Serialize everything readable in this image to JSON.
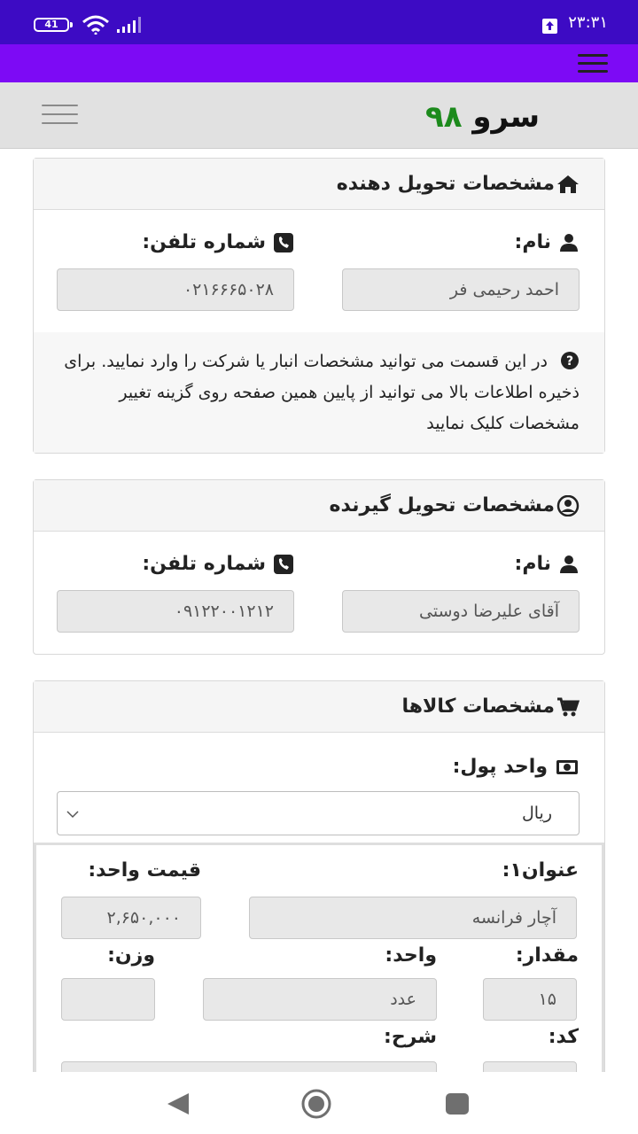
{
  "status_bar": {
    "battery": "41",
    "time": "۲۳:۳۱"
  },
  "app": {
    "logo_word": "سرو",
    "logo_number": "۹۸"
  },
  "sender": {
    "title": "مشخصات تحویل دهنده",
    "name_label": "نام:",
    "name_value": "احمد رحیمی فر",
    "phone_label": "شماره تلفن:",
    "phone_value": "۰۲۱۶۶۶۵۰۲۸",
    "help_text": "در این قسمت می توانید مشخصات انبار یا شرکت را وارد نمایید. برای ذخیره اطلاعات بالا می توانید از پایین همین صفحه روی گزینه تغییر مشخصات کلیک نمایید"
  },
  "receiver": {
    "title": "مشخصات تحویل گیرنده",
    "name_label": "نام:",
    "name_value": "آقای علیرضا دوستی",
    "phone_label": "شماره تلفن:",
    "phone_value": "۰۹۱۲۲۰۰۱۲۱۲"
  },
  "goods": {
    "title": "مشخصات کالاها",
    "currency_label": "واحد پول:",
    "currency_value": "ریال",
    "item": {
      "title_label": "عنوان۱:",
      "title_value": "آچار فرانسه",
      "unit_price_label": "قیمت واحد:",
      "unit_price_value": "۲,۶۵۰,۰۰۰",
      "quantity_label": "مقدار:",
      "quantity_value": "۱۵",
      "unit_label": "واحد:",
      "unit_value": "عدد",
      "weight_label": "وزن:",
      "weight_value": "",
      "code_label": "کد:",
      "description_label": "شرح:"
    }
  }
}
